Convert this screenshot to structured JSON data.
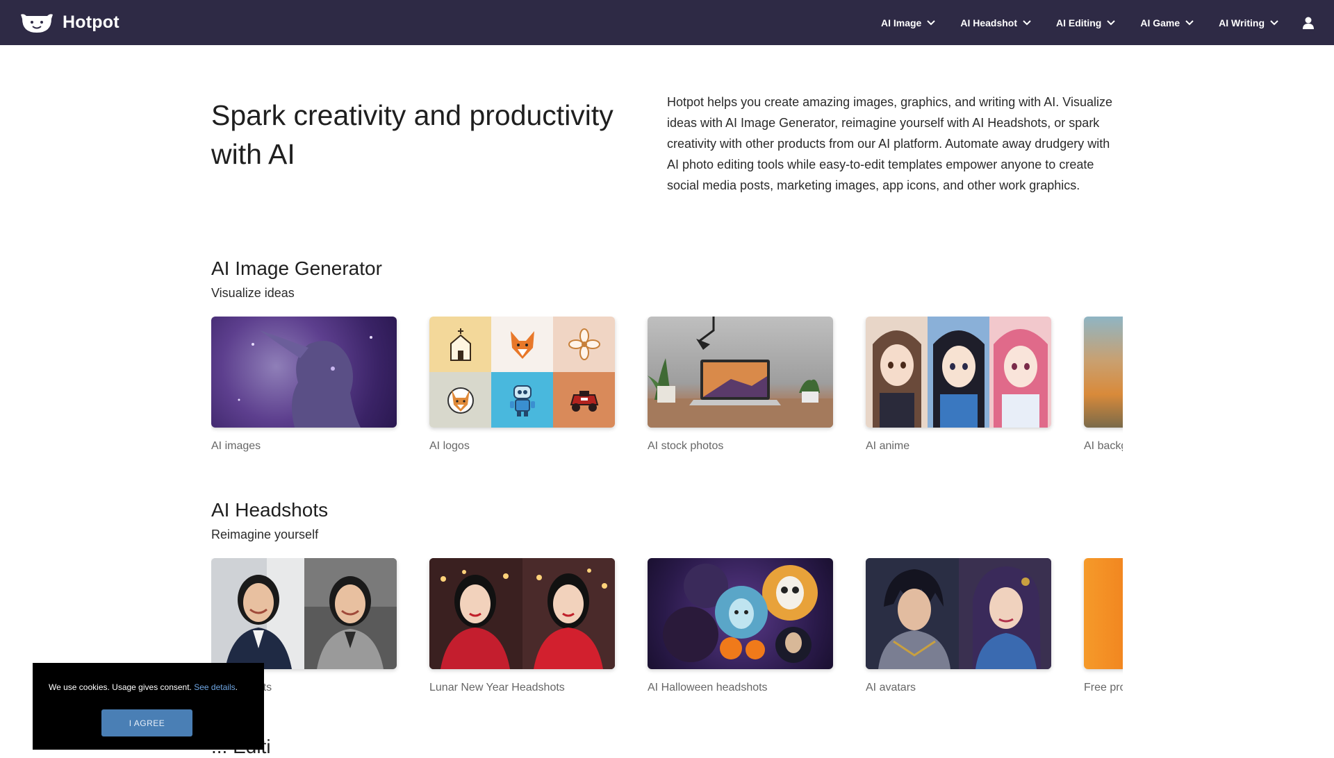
{
  "header": {
    "brand": "Hotpot",
    "nav": [
      "AI Image",
      "AI Headshot",
      "AI Editing",
      "AI Game",
      "AI Writing"
    ]
  },
  "hero": {
    "title": "Spark creativity and productivity with AI",
    "description": "Hotpot helps you create amazing images, graphics, and writing with AI. Visualize ideas with AI Image Generator, reimagine yourself with AI Headshots, or spark creativity with other products from our AI platform. Automate away drudgery with AI photo editing tools while easy-to-edit templates empower anyone to create social media posts, marketing images, app icons, and other work graphics."
  },
  "sections": [
    {
      "title": "AI Image Generator",
      "subtitle": "Visualize ideas",
      "cards": [
        "AI images",
        "AI logos",
        "AI stock photos",
        "AI anime",
        "AI backg"
      ]
    },
    {
      "title": "AI Headshots",
      "subtitle": "Reimagine yourself",
      "cards": [
        "e headshots",
        "Lunar New Year Headshots",
        "AI Halloween headshots",
        "AI avatars",
        "Free pro"
      ]
    }
  ],
  "next_section_title": "...  Editi",
  "cookie": {
    "text": "We use cookies. Usage gives consent.",
    "link": "See details",
    "period": ".",
    "button": "I AGREE"
  }
}
